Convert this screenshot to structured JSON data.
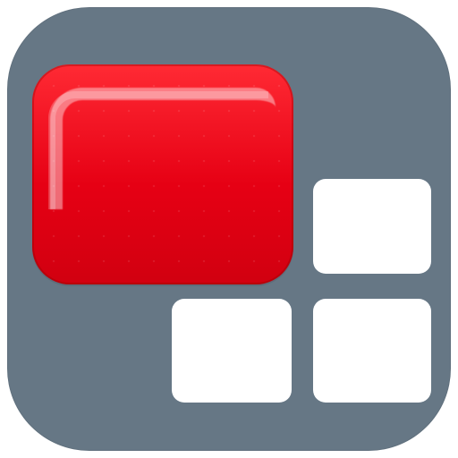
{
  "icon": {
    "name": "tiles-layout-app-icon",
    "background_color": "#667785",
    "primary_block_color": "#e60014",
    "tile_color": "#ffffff",
    "tiles": [
      {
        "id": "top-right"
      },
      {
        "id": "bottom-left"
      },
      {
        "id": "bottom-right"
      }
    ]
  }
}
